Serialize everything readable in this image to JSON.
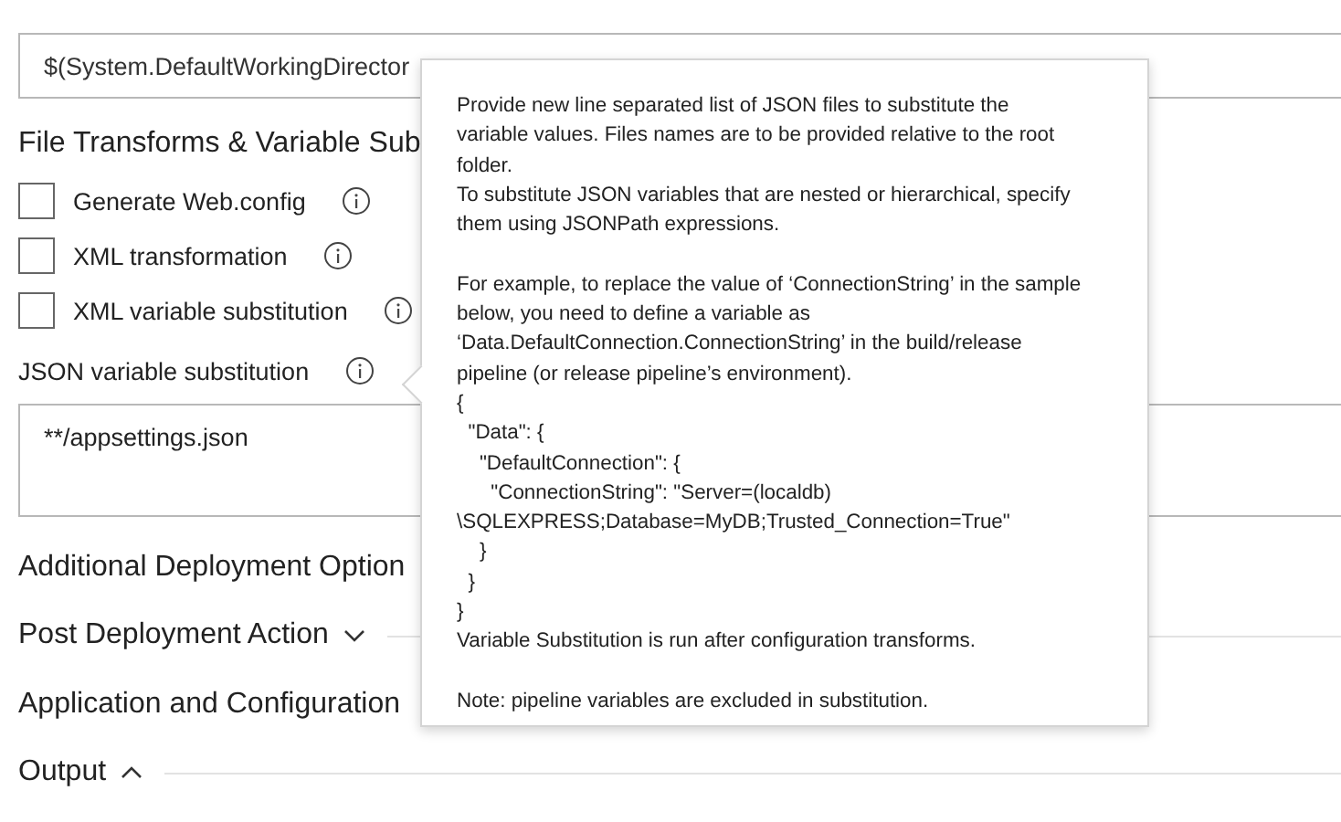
{
  "package_field": {
    "value": "$(System.DefaultWorkingDirector"
  },
  "file_transforms": {
    "title": "File Transforms & Variable Sub",
    "options": [
      {
        "label": "Generate Web.config",
        "checked": false
      },
      {
        "label": "XML transformation",
        "checked": false
      },
      {
        "label": "XML variable substitution",
        "checked": false
      }
    ],
    "json_substitution": {
      "label": "JSON variable substitution",
      "value": "**/appsettings.json"
    }
  },
  "sections": [
    {
      "title": "Additional Deployment Option"
    },
    {
      "title": "Post Deployment Action",
      "expanded": false
    },
    {
      "title": "Application and Configuration"
    },
    {
      "title": "Output",
      "expanded": true
    }
  ],
  "tooltip": {
    "paragraphs": [
      {
        "text": "Provide new line separated list of JSON files to substitute the variable values. Files names are to be provided relative to the root folder.",
        "spaced": false
      },
      {
        "text": "To substitute JSON variables that are nested or hierarchical, specify them using JSONPath expressions.",
        "spaced": false
      },
      {
        "text": "For example, to replace the value of ‘ConnectionString’ in the sample below, you need to define a variable as ‘Data.DefaultConnection.ConnectionString’ in the build/release pipeline (or release pipeline’s environment).",
        "spaced": true
      },
      {
        "text": "{\n  \"Data\": {\n    \"DefaultConnection\": {\n      \"ConnectionString\": \"Server=(localdb)\n\\SQLEXPRESS;Database=MyDB;Trusted_Connection=True\"\n    }\n  }\n}",
        "spaced": false
      },
      {
        "text": "Variable Substitution is run after configuration transforms.",
        "spaced": false
      },
      {
        "text": "Note: pipeline variables are excluded in substitution.",
        "spaced": true
      }
    ]
  }
}
